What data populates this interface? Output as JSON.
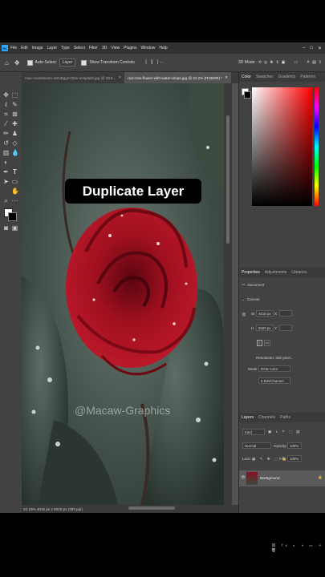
{
  "menubar": {
    "items": [
      "File",
      "Edit",
      "Image",
      "Layer",
      "Type",
      "Select",
      "Filter",
      "3D",
      "View",
      "Plugins",
      "Window",
      "Help"
    ]
  },
  "options": {
    "auto_select_label": "Auto-Select:",
    "auto_select_value": "Layer",
    "transform_label": "Show Transform Controls",
    "mode3d_label": "3D Mode:"
  },
  "tabs": [
    {
      "label": "max-muselmann-oWvBggeVlDw-unsplash.jpg @ 28.5..."
    },
    {
      "label": "red-rose-flower-with-water-drops.jpg @ 22.2% (RGB/8#) *"
    }
  ],
  "status": {
    "text": "22.18%   4016 px x 5020 px (300 ppi)"
  },
  "caption": {
    "text": "Duplicate Layer"
  },
  "watermark": {
    "text": "@Macaw-Graphics"
  },
  "color_panel": {
    "tabs": [
      "Color",
      "Swatches",
      "Gradients",
      "Patterns"
    ],
    "hue_color": "#ff0000"
  },
  "properties_panel": {
    "tabs": [
      "Properties",
      "Adjustments",
      "Libraries"
    ],
    "doc_label": "Document",
    "canvas_label": "Canvas",
    "width": "4016 px",
    "height": "5020 px",
    "w_label": "W",
    "h_label": "H",
    "x_label": "X",
    "y_label": "Y",
    "resolution": "Resolution: 300 pixel...",
    "mode_label": "Mode",
    "mode_value": "RGB Color",
    "depth_value": "8 Bits/Channel"
  },
  "layers_panel": {
    "tabs": [
      "Layers",
      "Channels",
      "Paths"
    ],
    "kind_placeholder": "Kind",
    "blend_mode": "Normal",
    "opacity_label": "Opacity:",
    "opacity_value": "100%",
    "lock_label": "Lock:",
    "fill_label": "Fill:",
    "fill_value": "100%",
    "layer_name": "Background"
  }
}
